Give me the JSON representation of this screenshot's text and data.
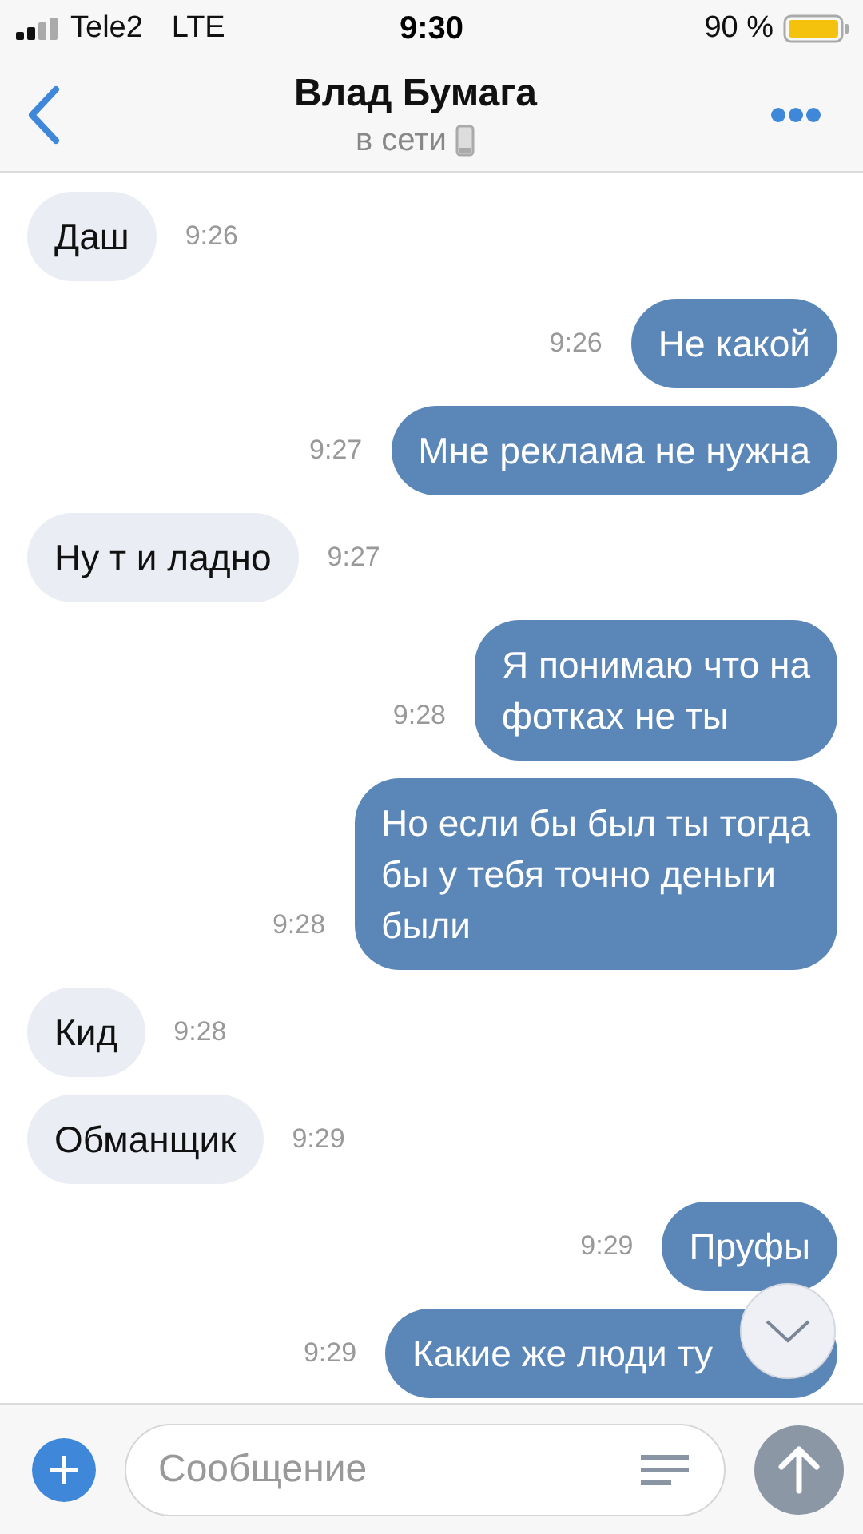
{
  "status_bar": {
    "carrier": "Tele2",
    "network": "LTE",
    "time": "9:30",
    "battery": "90 %"
  },
  "header": {
    "title": "Влад Бумага",
    "subtitle": "в сети"
  },
  "messages": [
    {
      "kind": "in",
      "text": "Даш",
      "time": "9:26"
    },
    {
      "kind": "out",
      "text": "Не какой",
      "time": "9:26"
    },
    {
      "kind": "out",
      "text": "Мне реклама не нужна",
      "time": "9:27"
    },
    {
      "kind": "in",
      "text": "Ну т и ладно",
      "time": "9:27"
    },
    {
      "kind": "out",
      "text": "Я понимаю что на\nфотках не ты",
      "time": "9:28"
    },
    {
      "kind": "out",
      "text": "Но если бы был ты тогда\nбы у тебя точно деньги\nбыли",
      "time": "9:28"
    },
    {
      "kind": "in",
      "text": "Кид",
      "time": "9:28"
    },
    {
      "kind": "in",
      "text": "Обманщик",
      "time": "9:29"
    },
    {
      "kind": "out",
      "text": "Пруфы",
      "time": "9:29"
    },
    {
      "kind": "out",
      "text": "Какие же люди ту",
      "time": "9:29"
    }
  ],
  "composer": {
    "placeholder": "Сообщение"
  }
}
